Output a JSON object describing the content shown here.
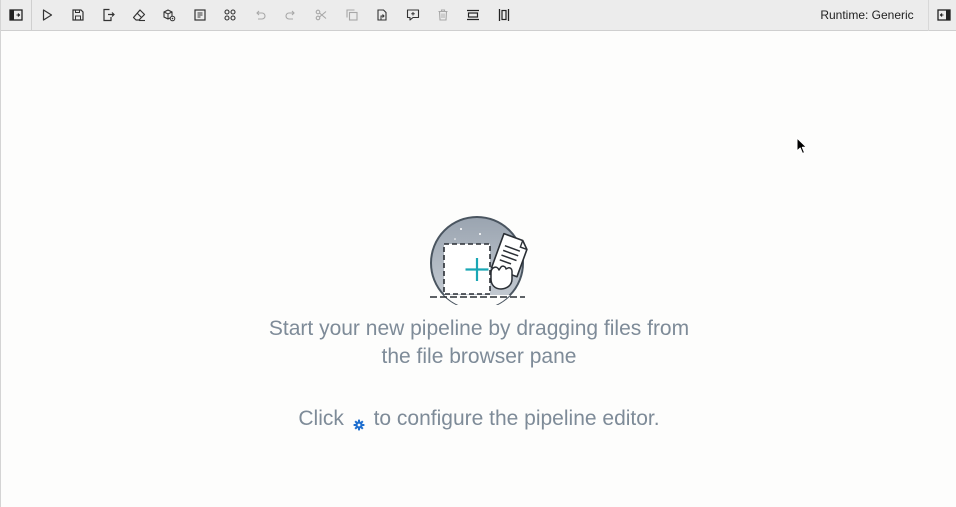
{
  "toolbar": {
    "left_buttons": [
      {
        "icon": "panel-left-icon",
        "label": "Toggle left panel",
        "enabled": true
      },
      {
        "icon": "run-icon",
        "label": "Run pipeline",
        "enabled": true
      },
      {
        "icon": "save-icon",
        "label": "Save pipeline",
        "enabled": true
      },
      {
        "icon": "export-icon",
        "label": "Export pipeline",
        "enabled": true
      },
      {
        "icon": "clear-icon",
        "label": "Clear pipeline",
        "enabled": true
      },
      {
        "icon": "runtime-images-icon",
        "label": "Open runtime images",
        "enabled": true
      },
      {
        "icon": "components-icon",
        "label": "Open component catalogs",
        "enabled": true
      },
      {
        "icon": "arrange-icon",
        "label": "Arrange",
        "enabled": true
      },
      {
        "icon": "undo-icon",
        "label": "Undo",
        "enabled": false
      },
      {
        "icon": "redo-icon",
        "label": "Redo",
        "enabled": false
      },
      {
        "icon": "cut-icon",
        "label": "Cut",
        "enabled": false
      },
      {
        "icon": "copy-icon",
        "label": "Copy",
        "enabled": false
      },
      {
        "icon": "paste-icon",
        "label": "Paste",
        "enabled": true
      },
      {
        "icon": "add-comment-icon",
        "label": "Add comment",
        "enabled": true
      },
      {
        "icon": "delete-icon",
        "label": "Delete",
        "enabled": false
      },
      {
        "icon": "arrange-horizontal-icon",
        "label": "Arrange horizontally",
        "enabled": true
      },
      {
        "icon": "arrange-vertical-icon",
        "label": "Arrange vertically",
        "enabled": true
      }
    ],
    "runtime_label": "Runtime: Generic",
    "right_button": {
      "icon": "panel-right-icon",
      "label": "Toggle right panel"
    }
  },
  "empty_state": {
    "line1": "Start your new pipeline by dragging files from",
    "line2": "the file browser pane",
    "configure_prefix": "Click",
    "configure_suffix": "to configure the pipeline editor.",
    "gear_icon": "gear-icon"
  },
  "colors": {
    "toolbar_bg": "#ececec",
    "message_text": "#7e8b98",
    "accent_gear": "#1f6fcf",
    "plus_teal": "#1aa7b5"
  }
}
